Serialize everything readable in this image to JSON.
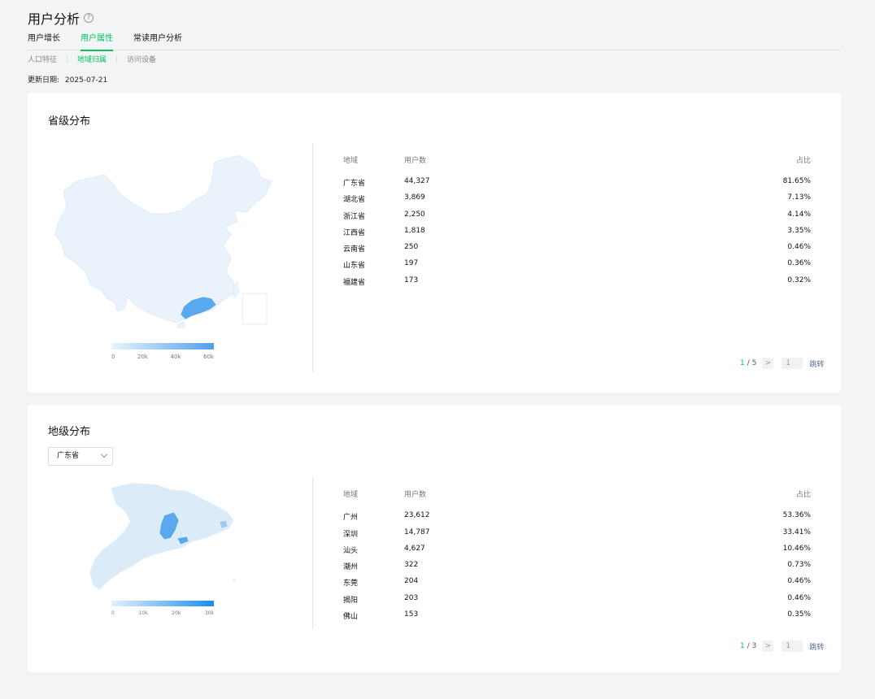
{
  "header": {
    "title": "用户分析",
    "help_icon": "?",
    "tabs": [
      {
        "label": "用户增长",
        "active": false
      },
      {
        "label": "用户属性",
        "active": true
      },
      {
        "label": "常读用户分析",
        "active": false
      }
    ],
    "subtabs": [
      {
        "label": "人口特征",
        "active": false
      },
      {
        "label": "地域归属",
        "active": true
      },
      {
        "label": "访问设备",
        "active": false
      }
    ],
    "update_label": "更新日期:",
    "update_date": "2025-07-21"
  },
  "province_card": {
    "title": "省级分布",
    "legend": [
      "0",
      "20k",
      "40k",
      "60k"
    ],
    "columns": {
      "region": "地域",
      "users": "用户数",
      "pct": "占比"
    },
    "rows": [
      {
        "region": "广东省",
        "users": "44,327",
        "pct": "81.65%"
      },
      {
        "region": "湖北省",
        "users": "3,869",
        "pct": "7.13%"
      },
      {
        "region": "浙江省",
        "users": "2,250",
        "pct": "4.14%"
      },
      {
        "region": "江西省",
        "users": "1,818",
        "pct": "3.35%"
      },
      {
        "region": "云南省",
        "users": "250",
        "pct": "0.46%"
      },
      {
        "region": "山东省",
        "users": "197",
        "pct": "0.36%"
      },
      {
        "region": "福建省",
        "users": "173",
        "pct": "0.32%"
      }
    ],
    "pager": {
      "current": "1",
      "total": "/ 5",
      "next": ">",
      "input": "1",
      "jump": "跳转"
    }
  },
  "city_card": {
    "title": "地级分布",
    "select_value": "广东省",
    "legend": [
      "0",
      "10k",
      "20k",
      "30k"
    ],
    "columns": {
      "region": "地域",
      "users": "用户数",
      "pct": "占比"
    },
    "rows": [
      {
        "region": "广州",
        "users": "23,612",
        "pct": "53.36%"
      },
      {
        "region": "深圳",
        "users": "14,787",
        "pct": "33.41%"
      },
      {
        "region": "汕头",
        "users": "4,627",
        "pct": "10.46%"
      },
      {
        "region": "潮州",
        "users": "322",
        "pct": "0.73%"
      },
      {
        "region": "东莞",
        "users": "204",
        "pct": "0.46%"
      },
      {
        "region": "揭阳",
        "users": "203",
        "pct": "0.46%"
      },
      {
        "region": "佛山",
        "users": "153",
        "pct": "0.35%"
      }
    ],
    "pager": {
      "current": "1",
      "total": "/ 3",
      "next": ">",
      "input": "1",
      "jump": "跳转"
    }
  },
  "colors": {
    "accent": "#07c160",
    "map_base": "#eaf3fc",
    "map_highlight": "#5aa9ee"
  }
}
